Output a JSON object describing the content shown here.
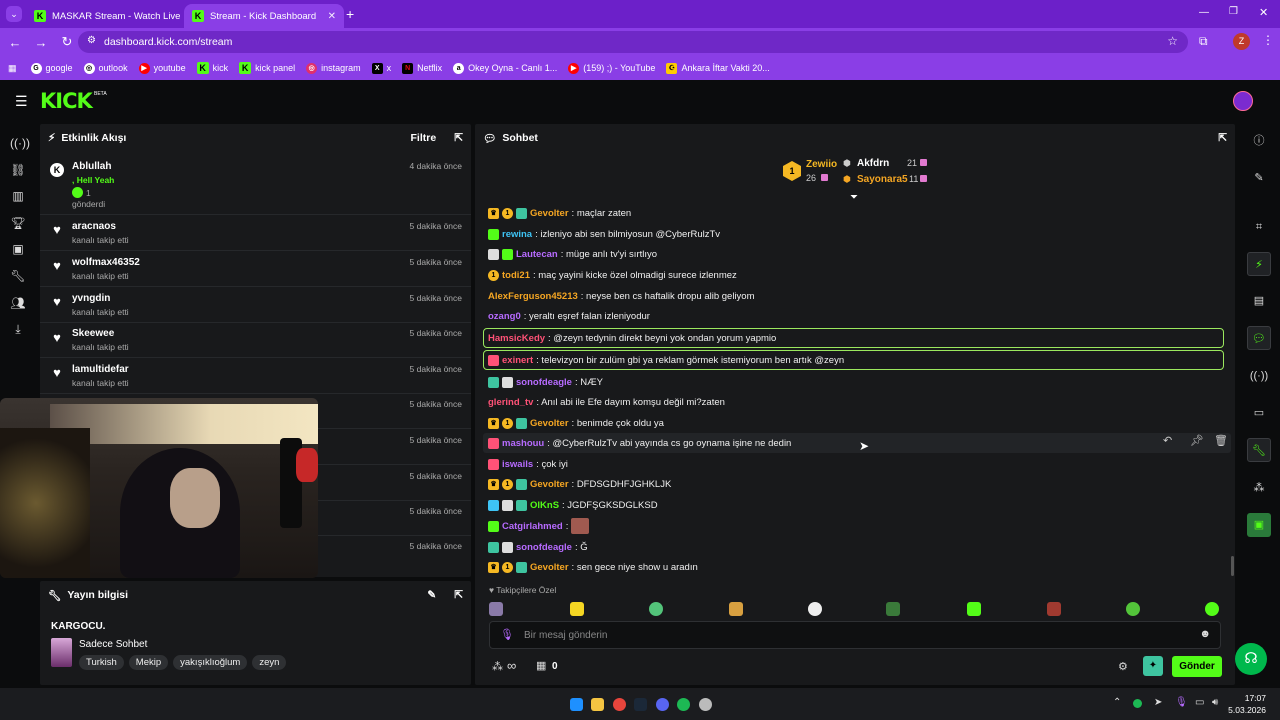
{
  "browser": {
    "tabs": [
      {
        "title": "MASKAR Stream - Watch Live o"
      },
      {
        "title": "Stream - Kick Dashboard"
      }
    ],
    "url": "dashboard.kick.com/stream",
    "profile_initial": "Z",
    "bookmarks": [
      "google",
      "outlook",
      "youtube",
      "kick",
      "kick panel",
      "instagram",
      "x",
      "Netflix",
      "Okey Oyna - Canlı 1...",
      "(159) ;) - YouTube",
      "Ankara İftar Vakti 20..."
    ]
  },
  "app": {
    "logo": "KICK",
    "logo_beta": "BETA"
  },
  "activity": {
    "title": "Etkinlik Akışı",
    "filter_label": "Filtre",
    "events": [
      {
        "name": "Ablullah",
        "line1": ", Hell Yeah",
        "count": "1",
        "line2": "gönderdi",
        "time": "4 dakika önce"
      },
      {
        "name": "aracnaos",
        "sub": "kanalı takip etti",
        "time": "5 dakika önce"
      },
      {
        "name": "wolfmax46352",
        "sub": "kanalı takip etti",
        "time": "5 dakika önce"
      },
      {
        "name": "yvngdin",
        "sub": "kanalı takip etti",
        "time": "5 dakika önce"
      },
      {
        "name": "Skeewee",
        "sub": "kanalı takip etti",
        "time": "5 dakika önce"
      },
      {
        "name": "lamultidefar",
        "sub": "kanalı takip etti",
        "time": "5 dakika önce"
      },
      {
        "time": "5 dakika önce"
      },
      {
        "time": "5 dakika önce"
      },
      {
        "time": "5 dakika önce"
      },
      {
        "time": "5 dakika önce"
      },
      {
        "time": "5 dakika önce"
      }
    ]
  },
  "stream_info": {
    "title": "Yayın bilgisi",
    "stream_title": "KARGOCU.",
    "category": "Sadece Sohbet",
    "tags": [
      "Turkish",
      "Mekip",
      "yakışıklıoğlum",
      "zeyn"
    ]
  },
  "chat": {
    "title": "Sohbet",
    "leaderboard": {
      "first_name": "Zewiio",
      "first_count": "26",
      "second_name": "Akfdrn",
      "second_count": "21",
      "third_name": "Sayonara5",
      "third_count": "11"
    },
    "messages": [
      {
        "user": "Gevolter",
        "color": "#f5a623",
        "text": ": maçlar zaten"
      },
      {
        "user": "rewina",
        "color": "#3ec4f5",
        "text": ": izleniyo abi sen bilmiyosun @CyberRulzTv"
      },
      {
        "user": "Lautecan",
        "color": "#b76bff",
        "text": ": müge anlı tv'yi sırtlıyo"
      },
      {
        "user": "todi21",
        "color": "#f5a623",
        "text": ": maç yayini kicke özel olmadigi surece izlenmez"
      },
      {
        "user": "AlexFerguson45213",
        "color": "#f5a623",
        "text": ": neyse ben cs haftalik dropu alib geliyom"
      },
      {
        "user": "ozang0",
        "color": "#b76bff",
        "text": ": yeraltı eşref falan izleniyodur"
      },
      {
        "user": "HamsicKedy",
        "color": "#ff5277",
        "text": ": @zeyn tedynin direkt beyni yok ondan yorum yapmio"
      },
      {
        "user": "exinert",
        "color": "#ff5277",
        "text": ": televizyon bir zulüm gbi ya reklam görmek istemiyorum ben artık @zeyn"
      },
      {
        "user": "sonofdeagle",
        "color": "#b76bff",
        "text": ": NÆY"
      },
      {
        "user": "glerind_tv",
        "color": "#ff5277",
        "text": ": Anıl abi ile Efe dayım komşu değil mi?zaten"
      },
      {
        "user": "Gevolter",
        "color": "#f5a623",
        "text": ": benimde çok oldu ya"
      },
      {
        "user": "mashouu",
        "color": "#b76bff",
        "text": ": @CyberRulzTv abi yayında cs go oynama işine ne dedin"
      },
      {
        "user": "iswails",
        "color": "#b76bff",
        "text": ": çok iyi"
      },
      {
        "user": "Gevolter",
        "color": "#f5a623",
        "text": ": DFDSGDHFJGHKLJK"
      },
      {
        "user": "OlKnS",
        "color": "#53fc18",
        "text": ": JGDFŞGKSDGLKSD"
      },
      {
        "user": "Catgirlahmed",
        "color": "#b76bff",
        "text": ":"
      },
      {
        "user": "sonofdeagle",
        "color": "#b76bff",
        "text": ": Ğ"
      },
      {
        "user": "Gevolter",
        "color": "#f5a623",
        "text": ": sen gece niye show u aradın"
      }
    ],
    "followers_only_label": "Takipçilere Özel",
    "input_placeholder": "Bir mesaj gönderin",
    "send_label": "Gönder",
    "points_value": "∞",
    "store_count": "0"
  },
  "taskbar": {
    "time": "17:07",
    "date": "5.03.2026"
  }
}
